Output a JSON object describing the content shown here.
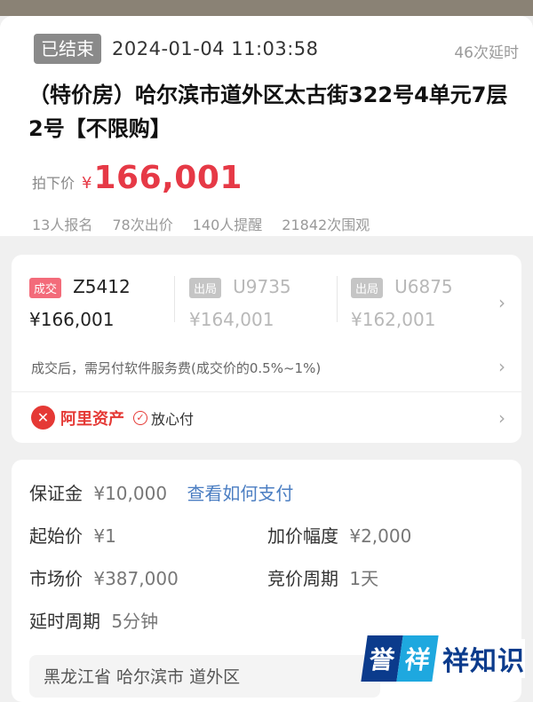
{
  "header": {
    "status": "已结束",
    "datetime": "2024-01-04 11:03:58",
    "delay": "46次延时",
    "title": "（特价房）哈尔滨市道外区太古街322号4单元7层2号【不限购】",
    "price_label": "拍下价",
    "price_currency": "¥",
    "price_value": "166,001",
    "stats": [
      "13人报名",
      "78次出价",
      "140人提醒",
      "21842次围观"
    ]
  },
  "bids": [
    {
      "tag": "成交",
      "code": "Z5412",
      "amount": "¥166,001",
      "won": true
    },
    {
      "tag": "出局",
      "code": "U9735",
      "amount": "¥164,001",
      "won": false
    },
    {
      "tag": "出局",
      "code": "U6875",
      "amount": "¥162,001",
      "won": false
    }
  ],
  "fee_note": "成交后，需另付软件服务费(成交价的0.5%~1%)",
  "ali": {
    "name": "阿里资产",
    "safe": "放心付",
    "logo_icon": "ali-asset-logo-icon"
  },
  "info": {
    "deposit_label": "保证金",
    "deposit_value": "¥10,000",
    "deposit_link": "查看如何支付",
    "start_label": "起始价",
    "start_value": "¥1",
    "increment_label": "加价幅度",
    "increment_value": "¥2,000",
    "market_label": "市场价",
    "market_value": "¥387,000",
    "cycle_label": "竞价周期",
    "cycle_value": "1天",
    "delay_label": "延时周期",
    "delay_value": "5分钟",
    "address": "黑龙江省  哈尔滨市  道外区"
  },
  "watermark": {
    "part_a": "誉",
    "part_b": "祥",
    "part_c": "祥知识"
  },
  "colors": {
    "accent": "#e63946",
    "link": "#4b7ec2",
    "ended_badge": "#8a8a8a"
  }
}
